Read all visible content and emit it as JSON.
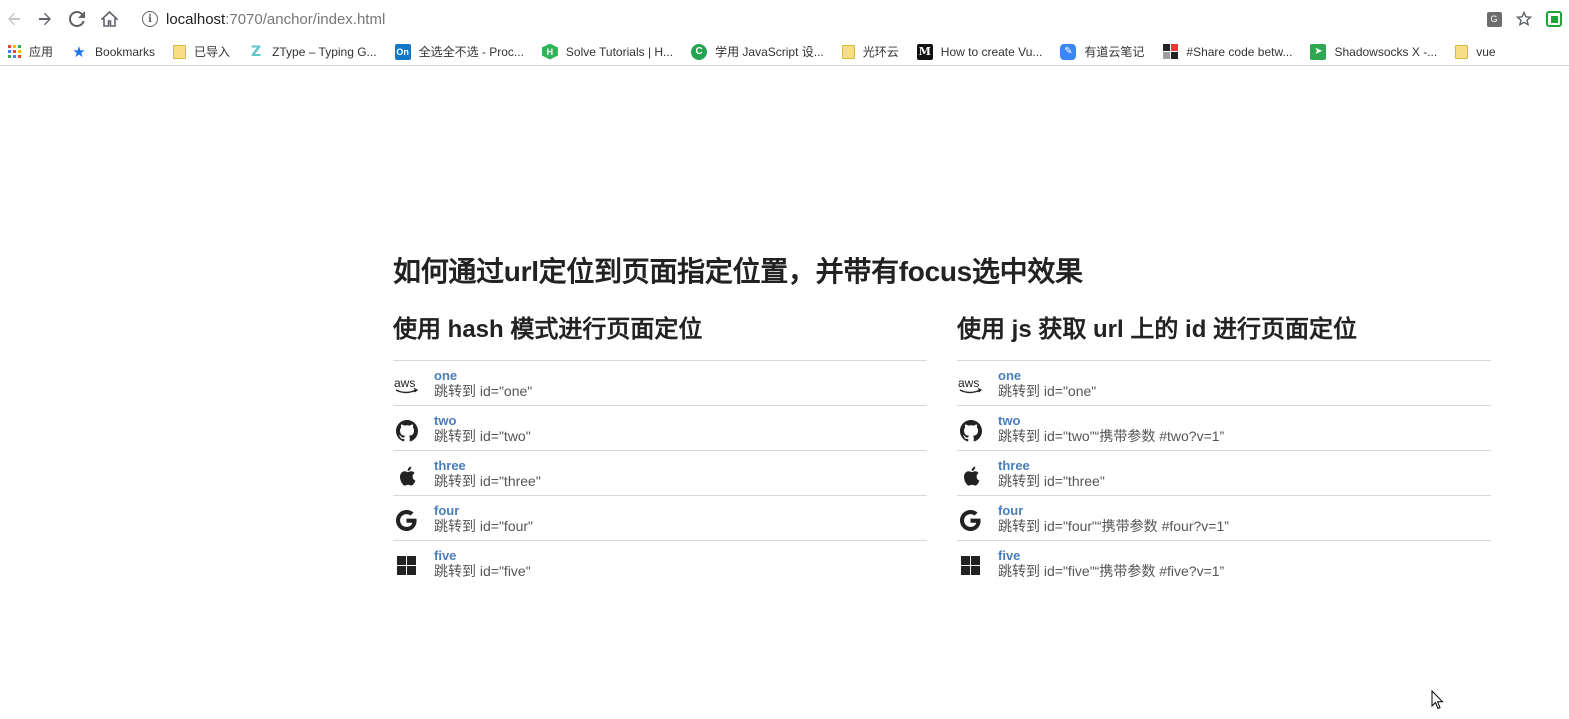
{
  "browser": {
    "url_host": "localhost",
    "url_path": ":7070/anchor/index.html",
    "back_icon": "arrow-left-icon",
    "forward_icon": "arrow-right-icon",
    "reload_icon": "reload-icon",
    "home_icon": "home-icon"
  },
  "bookmarks": [
    {
      "label": "应用",
      "icon": "apps-grid-icon"
    },
    {
      "label": "Bookmarks",
      "icon": "star-icon"
    },
    {
      "label": "已导入",
      "icon": "folder-icon"
    },
    {
      "label": "ZType – Typing G...",
      "icon": "ztype-icon"
    },
    {
      "label": "全选全不选 - Proc...",
      "icon": "on-icon"
    },
    {
      "label": "Solve Tutorials | H...",
      "icon": "hackerrank-icon"
    },
    {
      "label": "学用 JavaScript 设...",
      "icon": "c-icon"
    },
    {
      "label": "光环云",
      "icon": "folder-icon"
    },
    {
      "label": "How to create Vu...",
      "icon": "medium-icon"
    },
    {
      "label": "有道云笔记",
      "icon": "youdao-icon"
    },
    {
      "label": "#Share code betw...",
      "icon": "codeshare-icon"
    },
    {
      "label": "Shadowsocks X -...",
      "icon": "shadowsocks-icon"
    },
    {
      "label": "vue",
      "icon": "folder-icon"
    }
  ],
  "page": {
    "title": "如何通过url定位到页面指定位置，并带有focus选中效果",
    "left": {
      "title": "使用 hash 模式进行页面定位",
      "items": [
        {
          "name": "one",
          "desc": "跳转到 id=\"one\"",
          "icon": "aws-icon"
        },
        {
          "name": "two",
          "desc": "跳转到 id=\"two\"",
          "icon": "github-icon"
        },
        {
          "name": "three",
          "desc": "跳转到 id=\"three\"",
          "icon": "apple-icon"
        },
        {
          "name": "four",
          "desc": "跳转到 id=\"four\"",
          "icon": "google-icon"
        },
        {
          "name": "five",
          "desc": "跳转到 id=\"five\"",
          "icon": "windows-icon"
        }
      ]
    },
    "right": {
      "title": "使用 js 获取 url 上的 id 进行页面定位",
      "items": [
        {
          "name": "one",
          "desc": "跳转到 id=\"one\"",
          "icon": "aws-icon"
        },
        {
          "name": "two",
          "desc": "跳转到 id=\"two\"“携带参数 #two?v=1”",
          "icon": "github-icon"
        },
        {
          "name": "three",
          "desc": "跳转到 id=\"three\"",
          "icon": "apple-icon"
        },
        {
          "name": "four",
          "desc": "跳转到 id=\"four\"“携带参数 #four?v=1”",
          "icon": "google-icon"
        },
        {
          "name": "five",
          "desc": "跳转到 id=\"five\"“携带参数 #five?v=1”",
          "icon": "windows-icon"
        }
      ]
    }
  },
  "colors": {
    "link": "#4a7ebb",
    "heading": "#222222",
    "divider": "#d8d8d8"
  }
}
